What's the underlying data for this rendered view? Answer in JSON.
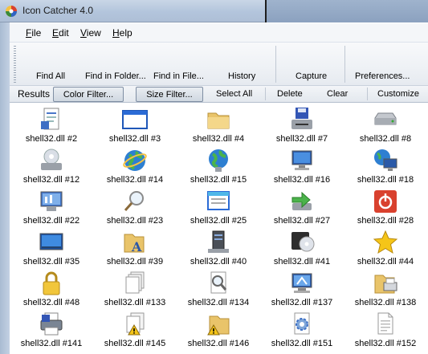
{
  "window": {
    "title": "Icon Catcher 4.0"
  },
  "menu": {
    "file": "ile",
    "file_key": "F",
    "edit": "dit",
    "edit_key": "E",
    "view": "iew",
    "view_key": "V",
    "help": "elp",
    "help_key": "H"
  },
  "toolbar": {
    "find_all": "Find All",
    "find_in_folder": "Find in Folder...",
    "find_in_file": "Find in File...",
    "history": "History",
    "capture": "Capture",
    "preferences": "Preferences..."
  },
  "filterbar": {
    "results": "Results",
    "color_filter": "Color Filter...",
    "size_filter": "Size Filter...",
    "select_all": "Select All",
    "delete": "Delete",
    "clear": "Clear",
    "customize": "Customize"
  },
  "icons": [
    {
      "label": "shell32.dll #2",
      "icon": "document-icon"
    },
    {
      "label": "shell32.dll #3",
      "icon": "window-icon"
    },
    {
      "label": "shell32.dll #4",
      "icon": "folder-icon"
    },
    {
      "label": "shell32.dll #7",
      "icon": "floppy-drive-icon"
    },
    {
      "label": "shell32.dll #8",
      "icon": "hard-drive-icon"
    },
    {
      "label": "shell32.dll #12",
      "icon": "cd-drive-icon"
    },
    {
      "label": "shell32.dll #14",
      "icon": "globe-icon"
    },
    {
      "label": "shell32.dll #15",
      "icon": "network-globe-icon"
    },
    {
      "label": "shell32.dll #16",
      "icon": "computer-icon"
    },
    {
      "label": "shell32.dll #18",
      "icon": "network-computer-icon"
    },
    {
      "label": "shell32.dll #22",
      "icon": "control-panel-icon"
    },
    {
      "label": "shell32.dll #23",
      "icon": "magnifier-icon"
    },
    {
      "label": "shell32.dll #25",
      "icon": "window-list-icon"
    },
    {
      "label": "shell32.dll #27",
      "icon": "arrow-drive-icon"
    },
    {
      "label": "shell32.dll #28",
      "icon": "power-icon"
    },
    {
      "label": "shell32.dll #35",
      "icon": "desktop-icon"
    },
    {
      "label": "shell32.dll #39",
      "icon": "font-folder-icon"
    },
    {
      "label": "shell32.dll #40",
      "icon": "server-icon"
    },
    {
      "label": "shell32.dll #41",
      "icon": "dvd-drive-icon"
    },
    {
      "label": "shell32.dll #44",
      "icon": "star-icon"
    },
    {
      "label": "shell32.dll #48",
      "icon": "padlock-icon"
    },
    {
      "label": "shell32.dll #133",
      "icon": "files-icon"
    },
    {
      "label": "shell32.dll #134",
      "icon": "search-document-icon"
    },
    {
      "label": "shell32.dll #137",
      "icon": "monitor-settings-icon"
    },
    {
      "label": "shell32.dll #138",
      "icon": "printer-folder-icon"
    },
    {
      "label": "shell32.dll #141",
      "icon": "printer-icon"
    },
    {
      "label": "shell32.dll #145",
      "icon": "warning-files-icon"
    },
    {
      "label": "shell32.dll #146",
      "icon": "warning-folder-icon"
    },
    {
      "label": "shell32.dll #151",
      "icon": "gear-document-icon"
    },
    {
      "label": "shell32.dll #152",
      "icon": "text-document-icon"
    }
  ]
}
